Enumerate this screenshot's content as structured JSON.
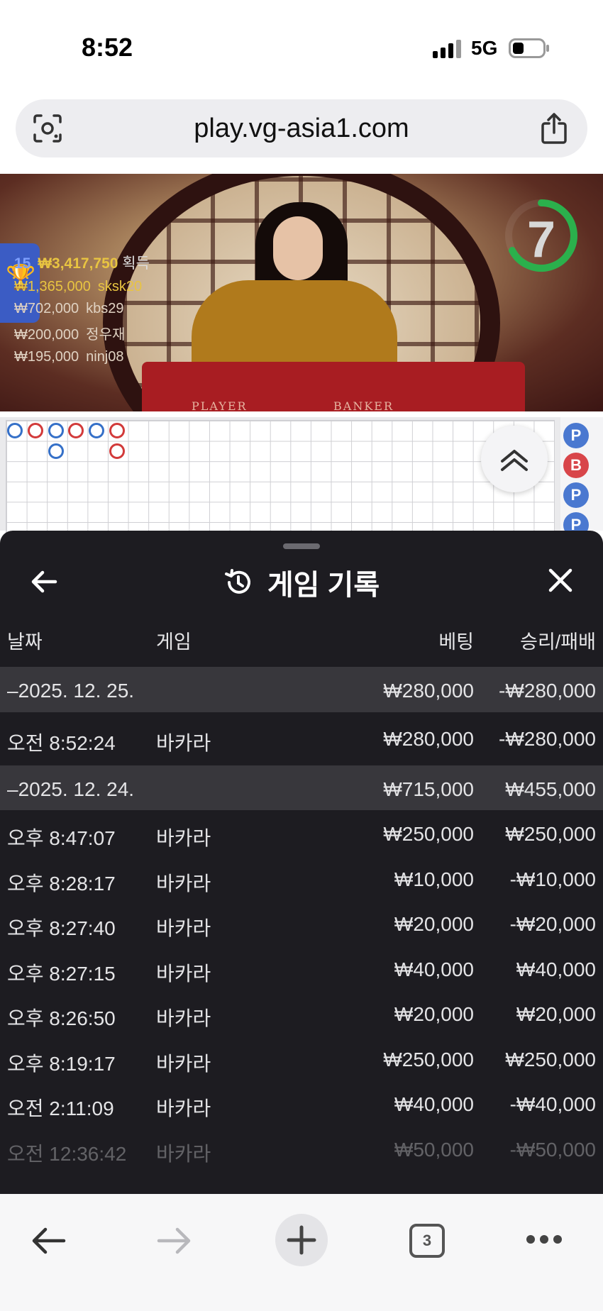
{
  "status_bar": {
    "time": "8:52",
    "network": "5G"
  },
  "browser": {
    "url": "play.vg-asia1.com",
    "tab_count": "3"
  },
  "video": {
    "countdown": "7",
    "table_labels": {
      "player": "PLAYER",
      "banker": "BANKER"
    },
    "top_winner": {
      "rank": "15",
      "amount": "₩3,417,750",
      "suffix": "획득"
    },
    "winners": [
      {
        "amount": "₩1,365,000",
        "name": "sksk20"
      },
      {
        "amount": "₩702,000",
        "name": "kbs29"
      },
      {
        "amount": "₩200,000",
        "name": "정우재"
      },
      {
        "amount": "₩195,000",
        "name": "ninj08"
      }
    ]
  },
  "roadmap": {
    "side_chips": [
      "P",
      "B",
      "P",
      "P"
    ]
  },
  "history": {
    "title": "게임 기록",
    "columns": {
      "date": "날짜",
      "game": "게임",
      "bet": "베팅",
      "result": "승리/패배"
    },
    "groups": [
      {
        "date": "–2025. 12. 25.",
        "bet": "₩280,000",
        "result": "-₩280,000",
        "rows": [
          {
            "time": "오전 8:52:24",
            "game": "바카라",
            "bet": "₩280,000",
            "result": "-₩280,000"
          }
        ]
      },
      {
        "date": "–2025. 12. 24.",
        "bet": "₩715,000",
        "result": "₩455,000",
        "rows": [
          {
            "time": "오후 8:47:07",
            "game": "바카라",
            "bet": "₩250,000",
            "result": "₩250,000"
          },
          {
            "time": "오후 8:28:17",
            "game": "바카라",
            "bet": "₩10,000",
            "result": "-₩10,000"
          },
          {
            "time": "오후 8:27:40",
            "game": "바카라",
            "bet": "₩20,000",
            "result": "-₩20,000"
          },
          {
            "time": "오후 8:27:15",
            "game": "바카라",
            "bet": "₩40,000",
            "result": "₩40,000"
          },
          {
            "time": "오후 8:26:50",
            "game": "바카라",
            "bet": "₩20,000",
            "result": "₩20,000"
          },
          {
            "time": "오후 8:19:17",
            "game": "바카라",
            "bet": "₩250,000",
            "result": "₩250,000"
          },
          {
            "time": "오전 2:11:09",
            "game": "바카라",
            "bet": "₩40,000",
            "result": "-₩40,000"
          },
          {
            "time": "오전 12:36:42",
            "game": "바카라",
            "bet": "₩50,000",
            "result": "-₩50,000"
          }
        ]
      }
    ]
  }
}
